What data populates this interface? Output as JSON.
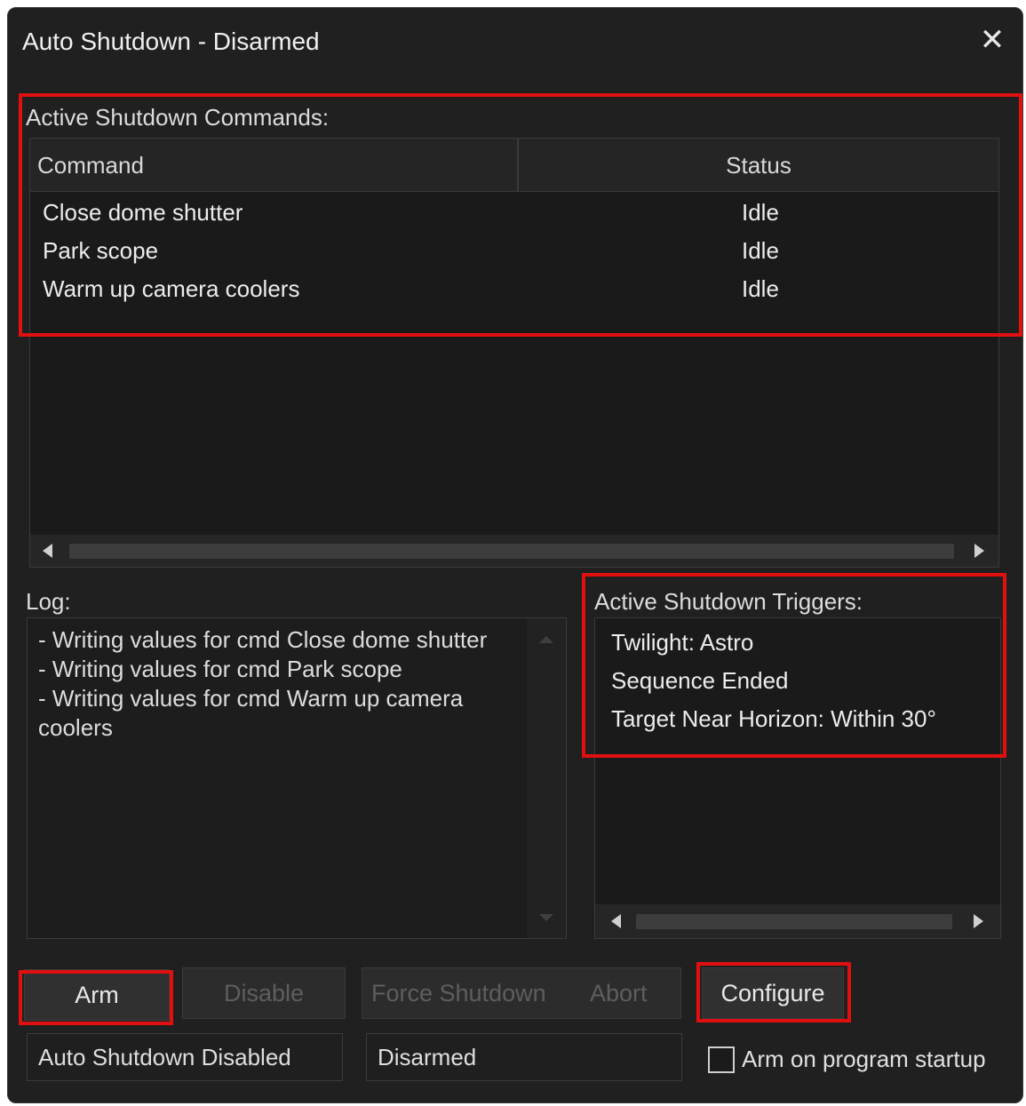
{
  "window": {
    "title": "Auto Shutdown - Disarmed",
    "close_glyph": "✕"
  },
  "commands": {
    "label": "Active Shutdown Commands:",
    "columns": {
      "command": "Command",
      "status": "Status"
    },
    "rows": [
      {
        "command": "Close dome shutter",
        "status": "Idle"
      },
      {
        "command": "Park scope",
        "status": "Idle"
      },
      {
        "command": "Warm up camera coolers",
        "status": "Idle"
      }
    ]
  },
  "log": {
    "label": "Log:",
    "lines": [
      "- Writing values for cmd Close dome shutter",
      "- Writing values for cmd Park scope",
      "- Writing values for cmd Warm up camera",
      "coolers"
    ]
  },
  "triggers": {
    "label": "Active Shutdown Triggers:",
    "items": [
      "Twilight: Astro",
      "Sequence Ended",
      "Target Near Horizon:  Within 30°"
    ]
  },
  "buttons": {
    "arm": "Arm",
    "disable": "Disable",
    "force_shutdown": "Force Shutdown",
    "abort": "Abort",
    "configure": "Configure"
  },
  "status": {
    "auto_shutdown": "Auto Shutdown Disabled",
    "arm_state": "Disarmed",
    "arm_on_startup_label": "Arm on program startup",
    "arm_on_startup_checked": false
  },
  "colors": {
    "highlight": "#e01010",
    "background": "#202020"
  }
}
